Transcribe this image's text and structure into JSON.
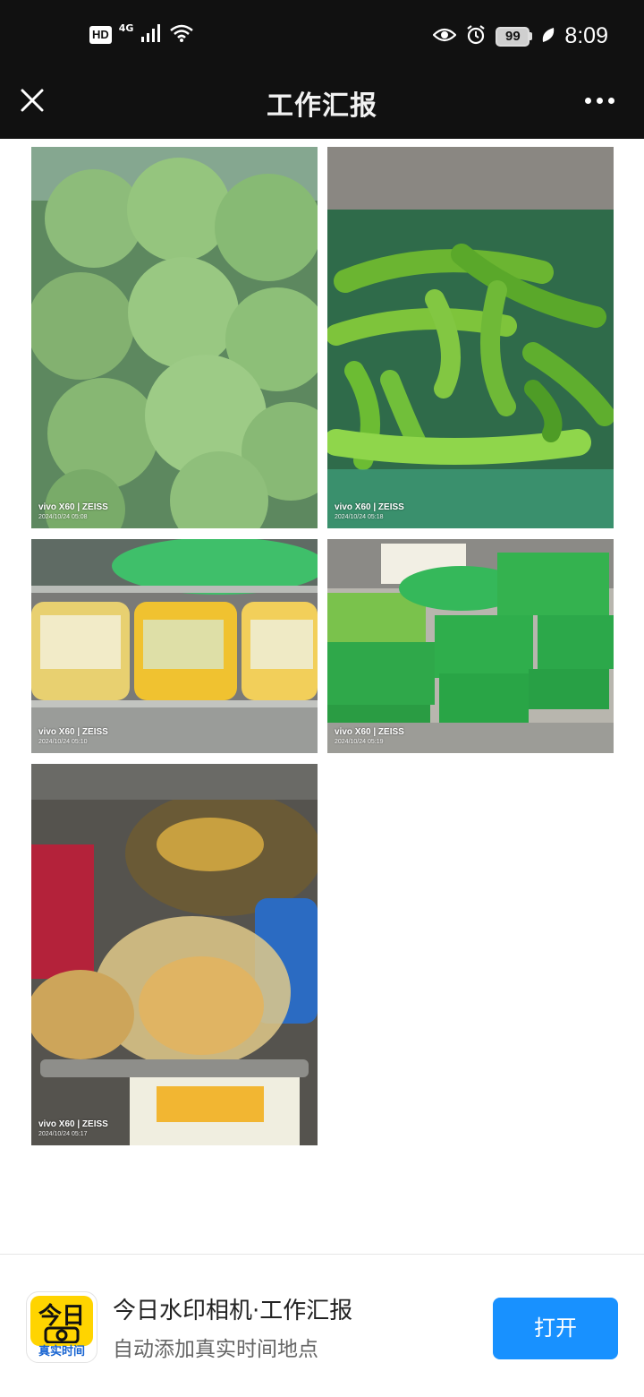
{
  "status_bar": {
    "hd": "HD",
    "network": "4G",
    "battery": "99",
    "time": "8:09"
  },
  "title_bar": {
    "title": "工作汇报",
    "close_icon": "close-icon",
    "more_icon": "more-dots-icon"
  },
  "photos": [
    {
      "subject": "cabbage",
      "brand": "vivo X60 | ZEISS",
      "date": "2024/10/24 05:08"
    },
    {
      "subject": "green-peppers",
      "brand": "vivo X60 | ZEISS",
      "date": "2024/10/24 05:18"
    },
    {
      "subject": "bagged-vegetables-shelf",
      "brand": "vivo X60 | ZEISS",
      "date": "2024/10/24 05:10"
    },
    {
      "subject": "green-crates",
      "brand": "vivo X60 | ZEISS",
      "date": "2024/10/24 05:19"
    },
    {
      "subject": "ginger-bags",
      "brand": "vivo X60 | ZEISS",
      "date": "2024/10/24 05:17"
    }
  ],
  "promo": {
    "app_icon_top": "今日",
    "app_icon_bottom": "真实时间",
    "title": "今日水印相机·工作汇报",
    "subtitle": "自动添加真实时间地点",
    "open_button": "打开"
  },
  "colors": {
    "top_bar": "#111111",
    "open_button": "#1891ff",
    "app_icon_yellow": "#ffd400"
  }
}
